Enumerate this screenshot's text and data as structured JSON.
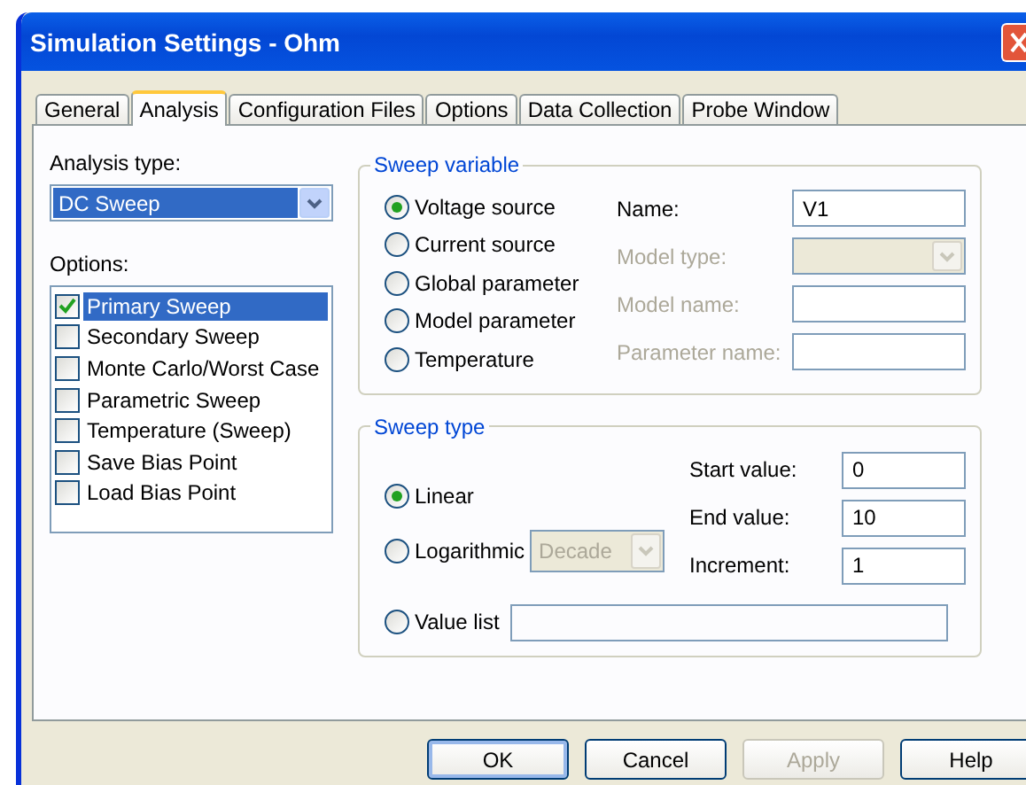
{
  "window": {
    "title": "Simulation Settings - Ohm"
  },
  "tabs": [
    {
      "label": "General",
      "selected": false
    },
    {
      "label": "Analysis",
      "selected": true
    },
    {
      "label": "Configuration Files",
      "selected": false
    },
    {
      "label": "Options",
      "selected": false
    },
    {
      "label": "Data Collection",
      "selected": false
    },
    {
      "label": "Probe Window",
      "selected": false
    }
  ],
  "analysis_type": {
    "label": "Analysis type:",
    "value": "DC Sweep"
  },
  "options": {
    "label": "Options:",
    "items": [
      {
        "label": "Primary Sweep",
        "checked": true,
        "selected": true
      },
      {
        "label": "Secondary Sweep",
        "checked": false,
        "selected": false
      },
      {
        "label": "Monte Carlo/Worst Case",
        "checked": false,
        "selected": false
      },
      {
        "label": "Parametric Sweep",
        "checked": false,
        "selected": false
      },
      {
        "label": "Temperature (Sweep)",
        "checked": false,
        "selected": false
      },
      {
        "label": "Save Bias Point",
        "checked": false,
        "selected": false
      },
      {
        "label": "Load Bias Point",
        "checked": false,
        "selected": false
      }
    ]
  },
  "sweep_variable": {
    "title": "Sweep variable",
    "sources": [
      {
        "label": "Voltage source",
        "selected": true
      },
      {
        "label": "Current source",
        "selected": false
      },
      {
        "label": "Global parameter",
        "selected": false
      },
      {
        "label": "Model parameter",
        "selected": false
      },
      {
        "label": "Temperature",
        "selected": false
      }
    ],
    "fields": [
      {
        "label": "Name:",
        "value": "V1",
        "kind": "text",
        "disabled": false
      },
      {
        "label": "Model type:",
        "kind": "dropdown",
        "disabled": true
      },
      {
        "label": "Model name:",
        "kind": "text",
        "disabled": true
      },
      {
        "label": "Parameter name:",
        "kind": "text",
        "disabled": true
      }
    ]
  },
  "sweep_type": {
    "title": "Sweep type",
    "types": [
      {
        "label": "Linear",
        "selected": true
      },
      {
        "label": "Logarithmic",
        "selected": false
      }
    ],
    "log_scale": {
      "value": "Decade",
      "disabled": true
    },
    "fields": [
      {
        "label": "Start value:",
        "value": "0"
      },
      {
        "label": "End value:",
        "value": "10"
      },
      {
        "label": "Increment:",
        "value": "1"
      }
    ],
    "value_list": {
      "label": "Value list",
      "selected": false
    }
  },
  "buttons": [
    {
      "label": "OK",
      "default": true,
      "disabled": false
    },
    {
      "label": "Cancel",
      "default": false,
      "disabled": false
    },
    {
      "label": "Apply",
      "default": false,
      "disabled": true
    },
    {
      "label": "Help",
      "default": false,
      "disabled": false
    }
  ]
}
